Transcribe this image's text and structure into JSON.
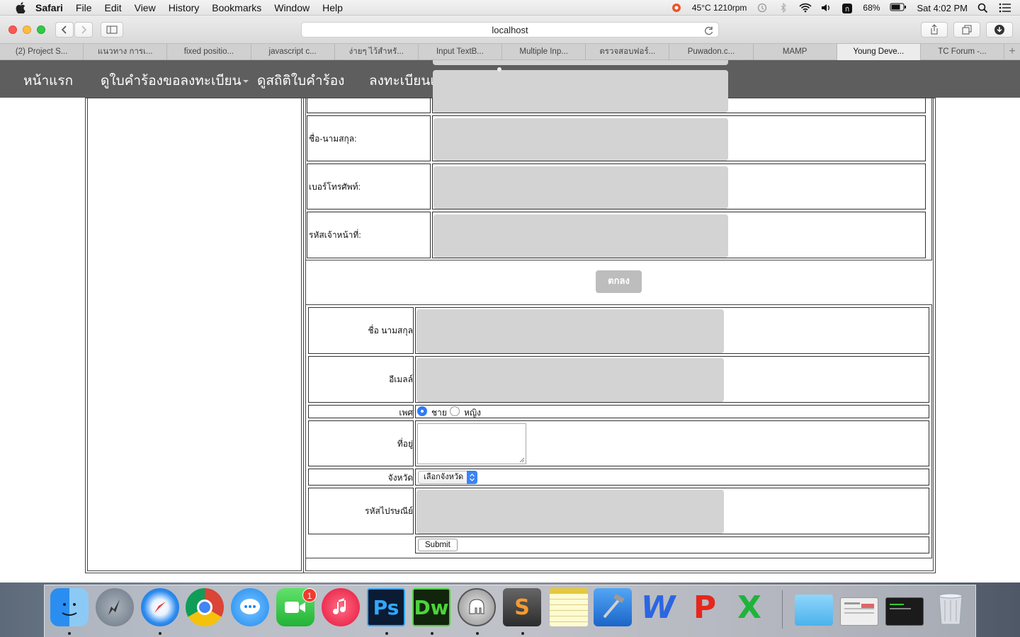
{
  "menubar": {
    "app_name": "Safari",
    "items": [
      "File",
      "Edit",
      "View",
      "History",
      "Bookmarks",
      "Window",
      "Help"
    ],
    "temp": "45°C 1210rpm",
    "battery": "68%",
    "clock": "Sat 4:02 PM"
  },
  "browser": {
    "url": "localhost",
    "tabs": [
      "(2) Project S...",
      "แนวทาง การเ...",
      "fixed positio...",
      "javascript c...",
      "ง่ายๆ ไว้สำหรั...",
      "Input TextB...",
      "Multiple Inp...",
      "ตรวจสอบฟอร์...",
      "Puwadon.c...",
      "MAMP",
      "Young Deve...",
      "TC Forum -..."
    ],
    "active_tab": 10
  },
  "nav": {
    "items": [
      "หน้าแรก",
      "ดูใบคำร้องขอลงทะเบียน",
      "ดูสถิติใบคำร้อง",
      "ลงทะเบียนเจ้"
    ]
  },
  "form1": {
    "fields": [
      "ชื่อ-นามสกุล:",
      "เบอร์โทรศัพท์:",
      "รหัสเจ้าหน้าที่:"
    ],
    "ok_label": "ตกลง"
  },
  "form2": {
    "name_label": "ชื่อ นามสกุล",
    "email_label": "อีเมลล์",
    "gender_label": "เพศ",
    "gender_options": [
      "ชาย",
      "หญิง"
    ],
    "gender_selected": "ชาย",
    "address_label": "ที่อยู่",
    "province_label": "จังหวัด",
    "province_value": "เลือกจังหวัด",
    "zip_label": "รหัสไปรษณีย์",
    "submit_label": "Submit"
  },
  "dock": {
    "apps": [
      "finder-icon",
      "launchpad-icon",
      "safari-icon",
      "chrome-icon",
      "messages-icon",
      "facetime-icon",
      "itunes-icon",
      "photoshop-icon",
      "dreamweaver-icon",
      "sequel-pro-icon",
      "sublime-text-icon",
      "notes-icon",
      "xcode-icon",
      "word-icon",
      "powerpoint-icon",
      "excel-icon",
      "folder-icon",
      "screenshot-icon",
      "terminal-icon",
      "trash-icon"
    ],
    "facetime_badge": "1",
    "ps_label": "Ps",
    "dw_label": "Dw",
    "w_label": "W",
    "p_label": "P",
    "x_label": "X",
    "s_label": "S"
  }
}
